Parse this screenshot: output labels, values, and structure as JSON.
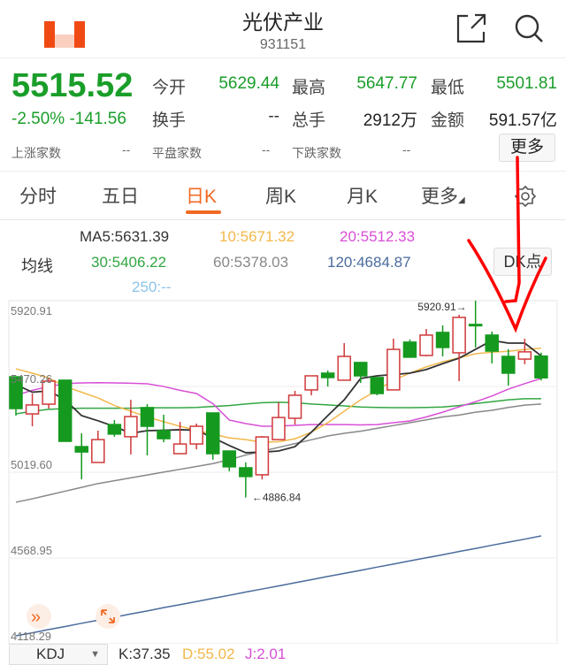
{
  "header": {
    "title": "光伏产业",
    "code": "931151",
    "share_icon": "share-icon",
    "search_icon": "search-icon"
  },
  "quote": {
    "price": "5515.52",
    "change_pct": "-2.50%",
    "change_abs": "-141.56",
    "open_label": "今开",
    "open": "5629.44",
    "high_label": "最高",
    "high": "5647.77",
    "low_label": "最低",
    "low": "5501.81",
    "turnover_label": "换手",
    "turnover": "--",
    "volume_label": "总手",
    "volume": "2912万",
    "amount_label": "金额",
    "amount": "591.57亿",
    "up_label": "上涨家数",
    "up": "--",
    "flat_label": "平盘家数",
    "flat": "--",
    "down_label": "下跌家数",
    "down": "--",
    "more_label": "更多"
  },
  "tabs": [
    {
      "label": "分时"
    },
    {
      "label": "五日"
    },
    {
      "label": "日K"
    },
    {
      "label": "周K"
    },
    {
      "label": "月K"
    },
    {
      "label": "更多"
    }
  ],
  "ma_legend": {
    "title": "均线",
    "ma5": "MA5:5631.39",
    "ma10": "10:5671.32",
    "ma20": "20:5512.33",
    "ma30": "30:5406.22",
    "ma60": "60:5378.03",
    "ma120": "120:4684.87",
    "ma250": "250:--",
    "dk_label": "DK点"
  },
  "colors": {
    "up": "#d0393a",
    "down": "#159a1f",
    "ma5": "#333333",
    "ma10": "#f2b84b",
    "ma20": "#d84fd6",
    "ma30": "#32a642",
    "ma60": "#888888",
    "ma120": "#4a6b9c",
    "accent": "#f06a24"
  },
  "chart_data": {
    "type": "candlestick",
    "y_ticks": [
      "5920.91",
      "5470.26",
      "5019.60",
      "4568.95",
      "4118.29"
    ],
    "ylim": [
      4118.29,
      5920.91
    ],
    "max_label": "5920.91",
    "min_label": "4886.84",
    "candles": [
      [
        5521,
        5354,
        5521,
        5317
      ],
      [
        5326,
        5373,
        5433,
        5261
      ],
      [
        5377,
        5498,
        5512,
        5354
      ],
      [
        5503,
        5182,
        5503,
        5182
      ],
      [
        5154,
        5126,
        5224,
        4982
      ],
      [
        5071,
        5191,
        5238,
        5071
      ],
      [
        5270,
        5220,
        5294,
        5206
      ],
      [
        5206,
        5312,
        5400,
        5113
      ],
      [
        5359,
        5261,
        5377,
        5108
      ],
      [
        5238,
        5196,
        5322,
        5177
      ],
      [
        5117,
        5168,
        5284,
        5117
      ],
      [
        5168,
        5261,
        5275,
        5140
      ],
      [
        5331,
        5117,
        5331,
        5085
      ],
      [
        5131,
        5048,
        5131,
        5024
      ],
      [
        5043,
        4997,
        5071,
        4886.84
      ],
      [
        5006,
        5205,
        5210,
        4982
      ],
      [
        5191,
        5307,
        5387,
        5191
      ],
      [
        5303,
        5424,
        5447,
        5270
      ],
      [
        5452,
        5526,
        5526,
        5424
      ],
      [
        5540,
        5517,
        5554,
        5470
      ],
      [
        5503,
        5628,
        5698,
        5503
      ],
      [
        5596,
        5526,
        5596,
        5489
      ],
      [
        5517,
        5433,
        5517,
        5424
      ],
      [
        5452,
        5665,
        5721,
        5452
      ],
      [
        5703,
        5624,
        5717,
        5624
      ],
      [
        5633,
        5740,
        5772,
        5628
      ],
      [
        5754,
        5675,
        5791,
        5628
      ],
      [
        5647,
        5833,
        5847,
        5498
      ],
      [
        5796,
        5791,
        5920.91,
        5675
      ],
      [
        5740,
        5656,
        5759,
        5591
      ],
      [
        5628,
        5540,
        5666,
        5475
      ],
      [
        5614,
        5652,
        5721,
        5587
      ],
      [
        5629.44,
        5515.52,
        5647.77,
        5501.81
      ]
    ],
    "ma": {
      "ma5": [
        5480,
        5440,
        5447,
        5400,
        5317,
        5290,
        5260,
        5224,
        5238,
        5240,
        5243,
        5240,
        5201,
        5160,
        5122,
        5125,
        5131,
        5154,
        5230,
        5317,
        5400,
        5512,
        5526,
        5533,
        5540,
        5559,
        5590,
        5619,
        5665,
        5712,
        5698,
        5698,
        5631
      ],
      "ma10": [
        5563,
        5540,
        5515,
        5470,
        5440,
        5410,
        5370,
        5340,
        5310,
        5285,
        5261,
        5240,
        5220,
        5200,
        5191,
        5177,
        5180,
        5195,
        5230,
        5280,
        5340,
        5400,
        5450,
        5503,
        5540,
        5573,
        5600,
        5620,
        5642,
        5650,
        5655,
        5665,
        5671
      ],
      "ma20": [
        5424,
        5450,
        5470,
        5485,
        5489,
        5490,
        5489,
        5487,
        5484,
        5470,
        5450,
        5433,
        5380,
        5294,
        5275,
        5261,
        5262,
        5266,
        5270,
        5270,
        5270,
        5268,
        5270,
        5280,
        5289,
        5310,
        5335,
        5363,
        5390,
        5420,
        5456,
        5485,
        5512
      ],
      "ma30": [
        5326,
        5340,
        5350,
        5354,
        5356,
        5356,
        5356,
        5356,
        5358,
        5358,
        5358,
        5360,
        5365,
        5370,
        5378,
        5385,
        5387,
        5385,
        5378,
        5373,
        5368,
        5362,
        5360,
        5359,
        5359,
        5360,
        5362,
        5370,
        5380,
        5390,
        5400,
        5406,
        5406
      ],
      "ma60": [
        4862,
        4880,
        4900,
        4920,
        4940,
        4960,
        4975,
        4990,
        5005,
        5020,
        5035,
        5050,
        5065,
        5085,
        5110,
        5130,
        5150,
        5170,
        5190,
        5210,
        5224,
        5235,
        5250,
        5265,
        5280,
        5295,
        5310,
        5320,
        5335,
        5345,
        5360,
        5372,
        5378
      ],
      "ma120": [
        4160,
        4176,
        4193,
        4209,
        4226,
        4242,
        4258,
        4275,
        4291,
        4308,
        4324,
        4340,
        4357,
        4373,
        4390,
        4406,
        4422,
        4439,
        4455,
        4472,
        4488,
        4504,
        4521,
        4537,
        4554,
        4570,
        4586,
        4603,
        4619,
        4636,
        4652,
        4668,
        4685
      ]
    }
  },
  "indicator": {
    "name": "KDJ",
    "k": "K:37.35",
    "d": "D:55.02",
    "j": "J:2.01"
  }
}
